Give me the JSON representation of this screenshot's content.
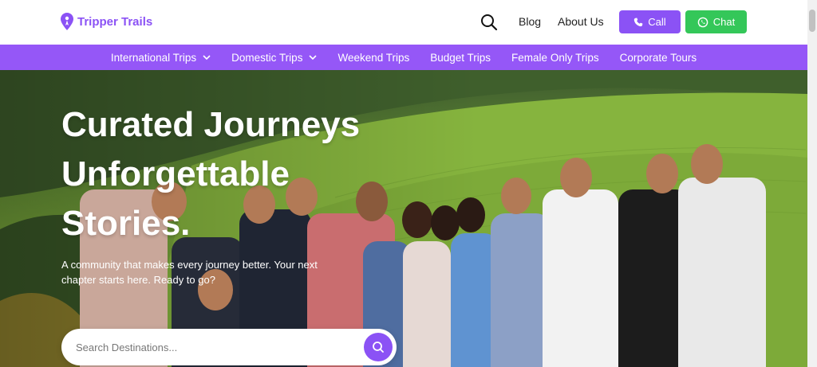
{
  "brand": {
    "name": "Tripper Trails",
    "accent": "#8b52f5"
  },
  "header": {
    "links": [
      {
        "label": "Blog"
      },
      {
        "label": "About Us"
      }
    ],
    "call_label": "Call",
    "chat_label": "Chat",
    "icons": {
      "search": "search-icon",
      "call": "phone-icon",
      "chat": "whatsapp-icon"
    }
  },
  "menu": {
    "items": [
      {
        "label": "International Trips",
        "dropdown": true
      },
      {
        "label": "Domestic Trips",
        "dropdown": true
      },
      {
        "label": "Weekend Trips"
      },
      {
        "label": "Budget Trips"
      },
      {
        "label": "Female Only Trips"
      },
      {
        "label": "Corporate Tours"
      }
    ],
    "color": "#9557f7"
  },
  "hero": {
    "title_lines": [
      "Curated Journeys",
      "Unforgettable",
      "Stories."
    ],
    "subtitle": "A community that makes every journey better. Your next chapter starts here. Ready to go?",
    "search_placeholder": "Search Destinations..."
  },
  "colors": {
    "call": "#8b52f5",
    "chat": "#34c759"
  }
}
